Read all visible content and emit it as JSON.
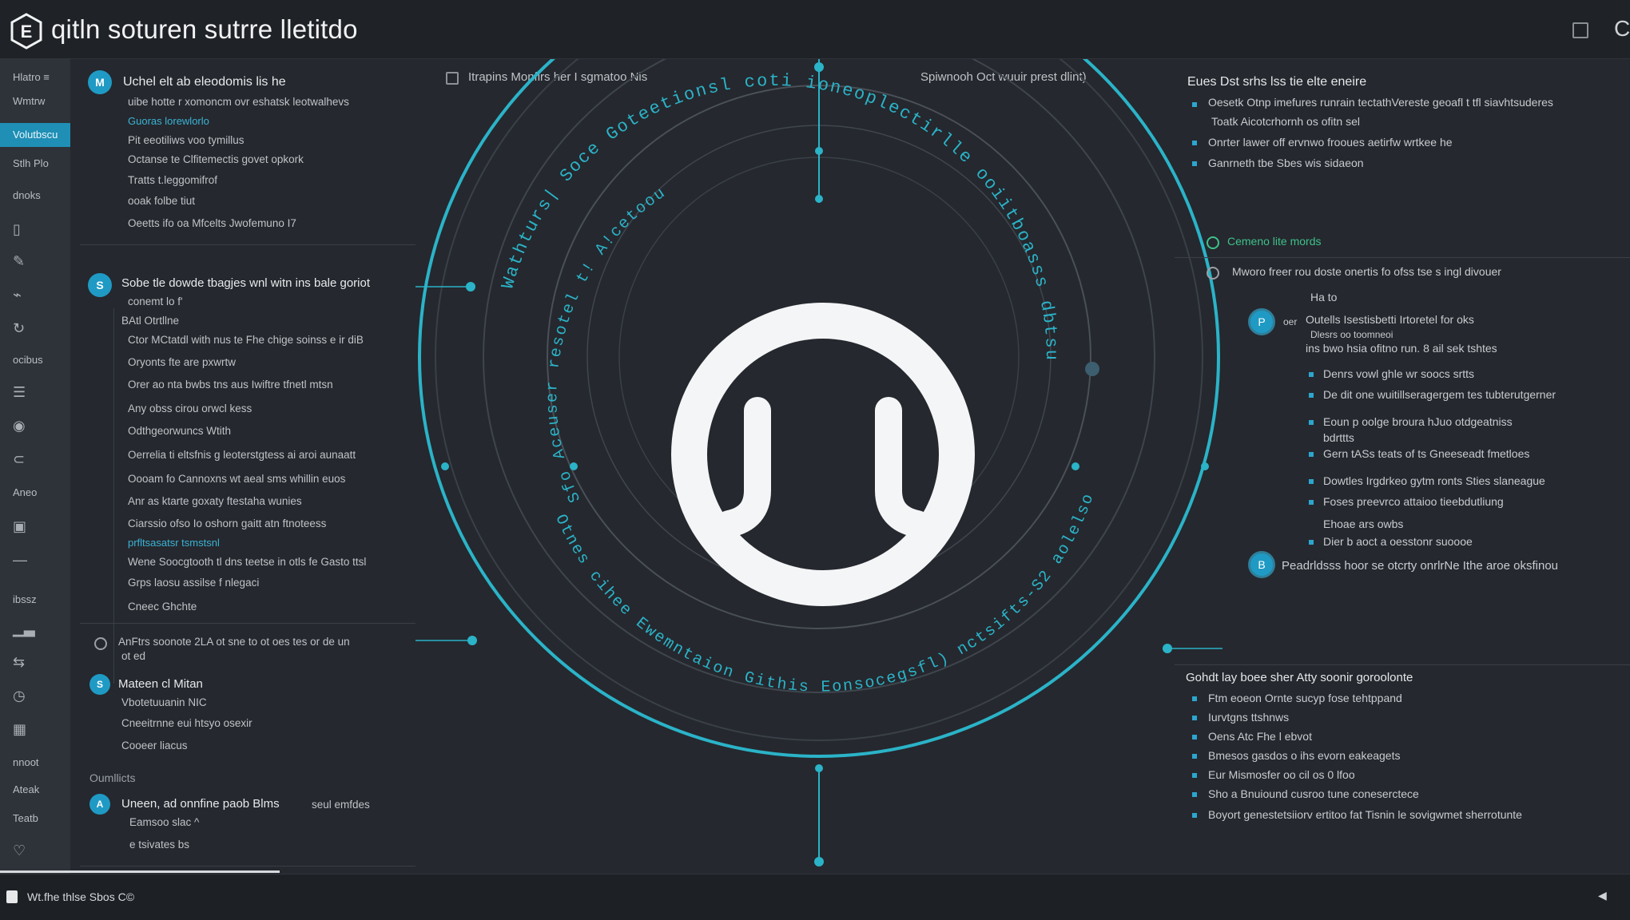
{
  "window": {
    "title": "qitln soturen sutrre lletitdo",
    "logo_letter": "E",
    "maximize_icon": "maximize-icon",
    "edge_glyph": "C"
  },
  "sidebar": {
    "items": [
      {
        "label": "Hlatro  ≡",
        "icon": null
      },
      {
        "label": "Wmtrw",
        "icon": null
      },
      {
        "label": "Volutbscu",
        "icon": null,
        "active": true
      },
      {
        "label": "Stlh Plo",
        "icon": "gate-icon"
      },
      {
        "label": "dnoks",
        "icon": null
      },
      {
        "label": "",
        "icon": "document-icon"
      },
      {
        "label": "",
        "icon": "edit-icon"
      },
      {
        "label": "",
        "icon": "signal-icon"
      },
      {
        "label": "",
        "icon": "refresh-icon"
      },
      {
        "label": "ocibus",
        "icon": null
      },
      {
        "label": "",
        "icon": "list-icon"
      },
      {
        "label": "",
        "icon": "eye-icon"
      },
      {
        "label": "",
        "icon": "link-icon"
      },
      {
        "label": "Aneo",
        "icon": null
      },
      {
        "label": "",
        "icon": "window-icon"
      },
      {
        "label": "",
        "icon": "dash-icon"
      },
      {
        "label": "ibssz",
        "icon": null
      },
      {
        "label": "",
        "icon": "chart-icon"
      },
      {
        "label": "",
        "icon": "share-icon"
      },
      {
        "label": "",
        "icon": "clock-icon"
      },
      {
        "label": "",
        "icon": "grid-icon"
      },
      {
        "label": "nnoot",
        "icon": "box-icon"
      },
      {
        "label": "Ateak",
        "icon": "arrow-icon"
      },
      {
        "label": "Teatb",
        "icon": null
      },
      {
        "label": "",
        "icon": "heart-icon"
      }
    ]
  },
  "left": {
    "section1": {
      "badge": "M",
      "title": "Uchel elt ab eleodomis lis he",
      "lines": [
        "uibe hotte r xomoncm ovr eshatsk leotwalhevs",
        "Guoras lorewlorlo",
        "Pit eeotiliws voo tymillus",
        "Octanse te Clfitemectis govet opkork",
        "Tratts t.leggomifrof",
        "ooak folbe tiut",
        "Oeetts ifo oa Mfcelts Jwofemuno I7"
      ]
    },
    "section2": {
      "badge": "S",
      "title": "Sobe tle dowde tbagjes wnl witn ins bale goriot",
      "lines": [
        "conemt lo f'",
        "BAtl Otrtllne",
        "Ctor MCtatdl with nus te Fhe chige soinss e ir diB",
        "Oryonts fte are pxwrtw",
        "Orer ao nta bwbs tns aus Iwiftre tfnetl mtsn",
        "Any obss cirou orwcl kess",
        "Odthgeorwuncs Wtith",
        "Oerrelia ti eltsfnis g leoterstgtess ai aroi aunaatt",
        "Oooam fo Cannoxns wt aeal sms whillin euos",
        "Anr as ktarte goxaty ftestaha wunies",
        "Ciarssio ofso Io oshorn gaitt atn ftnoteess",
        "prfltsasatsr tsmstsnl",
        "Wene Soocgtooth tl dns teetse in otls fe Gasto ttsl",
        "Grps laosu assilse f nlegaci",
        "Cneec Ghchte"
      ]
    },
    "section3": {
      "note": "AnFtrs soonote 2LA ot sne to ot oes tes or de un",
      "note2": "ot ed"
    },
    "section4": {
      "badge": "S",
      "title": "Mateen cl Mitan",
      "lines": [
        "Vbotetuuanin NIC",
        "Cneeitrnne eui htsyo osexir",
        "Cooeer liacus"
      ]
    },
    "section5": {
      "heading": "Oumllicts",
      "badge": "A",
      "title": "Uneen, ad onnfine paob Blms",
      "aside": "seul emfdes",
      "lines": [
        "Eamsoo slac ^",
        "e tsivates bs"
      ]
    }
  },
  "center": {
    "checkbox_label": "Itrapins Monfirs her I sgmatoo Nis",
    "top_right_note": "Spiwnooh Oct wuuir prest dlint)",
    "ring_text_outer": "Wathturs| Soce Goteetionsl coti ioneoplectirlle ooiitboasss dbtsurtdshun",
    "ring_text_left": "Sfo Aceuser resotel t! A!cetoou eeolle)",
    "ring_text_bottom": "Otnes cihee Ewemntaion Githis Eonsocegsfl) nctsifts-S2 aolelsoy",
    "accent": "#2bb3c8"
  },
  "right": {
    "block1": {
      "title": "Eues Dst srhs lss tie elte eneire",
      "lines": [
        "Oesetk Otnp imefures runrain tectathVereste geoafl t tfl siavhtsuderes",
        "Toatk Aicotcrhornh os ofitn sel",
        "Onrter lawer off ervnwo frooues aetirfw wrtkee he",
        "Ganrneth tbe Sbes wis sidaeon"
      ]
    },
    "block2": {
      "green": "Cemeno lite mords",
      "line": "Mworo freer rou doste onertis fo ofss tse s ingl divouer",
      "sub": "Ha to"
    },
    "block3": {
      "badge": "P",
      "prefix": "oer",
      "title": "Outells Isestisbetti Irtoretel for oks",
      "sub1": "Dlesrs oo toomneoi",
      "sub2": "ins bwo hsia ofitno run. 8 ail sek tshtes",
      "bullets": [
        "Denrs vowl ghle wr soocs srtts",
        "De dit one wuitillseragergem tes tubterutgerner",
        "Eoun p oolge broura hJuo otdgeatniss",
        "bdrttts",
        "Gern tASs teats of ts Gneeseadt fmetloes",
        "Dowtles Irgdrkeo gytm ronts Sties slaneague",
        "Foses preevrco attaioo tieebdutliung",
        "Ehoae ars owbs",
        "Dier b aoct a oesstonr suoooe"
      ]
    },
    "block4": {
      "badge": "B",
      "title": "Peadrldsss hoor se otcrty onrlrNe Ithe aroe oksfinou"
    },
    "block5": {
      "title": "Gohdt lay boee sher Atty soonir goroolonte",
      "bullets": [
        "Ftm eoeon Ornte sucyp fose tehtppand",
        "Iurvtgns ttshnws",
        "Oens Atc Fhe l ebvot",
        "Bmesos gasdos o ihs evorn eakeagets",
        "Eur Mismosfer oo cil os 0 lfoo",
        "Sho a Bnuiound cusroo tune coneserctece",
        "Boyort genestetsiiorv ertitoo fat Tisnin le sovigwmet sherrotunte"
      ]
    }
  },
  "status": {
    "text": "Wt.fhe thlse Sbos C©",
    "right_glyph": "◀"
  }
}
